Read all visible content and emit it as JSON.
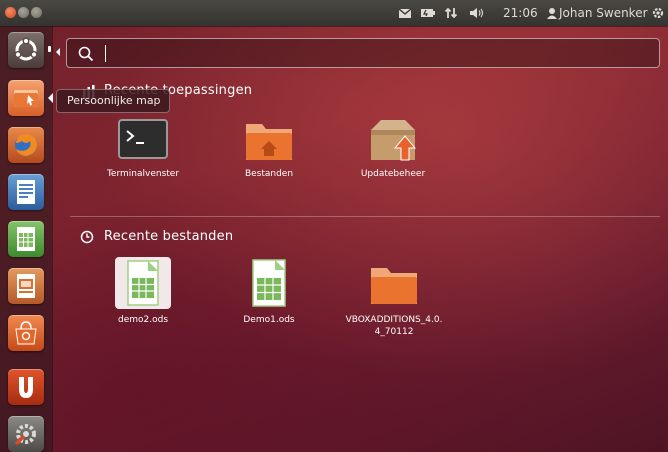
{
  "panel": {
    "time": "21:06",
    "user": "Johan Swenker"
  },
  "launcher": {
    "tooltip": "Persoonlijke map",
    "items": [
      "dash-home",
      "home-folder",
      "firefox",
      "libreoffice-writer",
      "libreoffice-calc",
      "libreoffice-impress",
      "ubuntu-software-center",
      "ubuntu-one",
      "system-settings"
    ]
  },
  "dash": {
    "search_value": "",
    "recent_apps_heading": "Recente toepassingen",
    "recent_files_heading": "Recente bestanden",
    "apps": [
      {
        "label": "Terminalvenster",
        "icon": "terminal-icon"
      },
      {
        "label": "Bestanden",
        "icon": "folder-home-icon"
      },
      {
        "label": "Updatebeheer",
        "icon": "update-manager-icon"
      }
    ],
    "files": [
      {
        "label": "demo2.ods",
        "icon": "spreadsheet-icon"
      },
      {
        "label": "Demo1.ods",
        "icon": "spreadsheet-icon"
      },
      {
        "label_line1": "VBOXADDITIONS_4.0.",
        "label_line2": "4_70112",
        "icon": "folder-icon"
      }
    ]
  },
  "colors": {
    "accent": "#dd4814",
    "background": "#7a2430"
  }
}
